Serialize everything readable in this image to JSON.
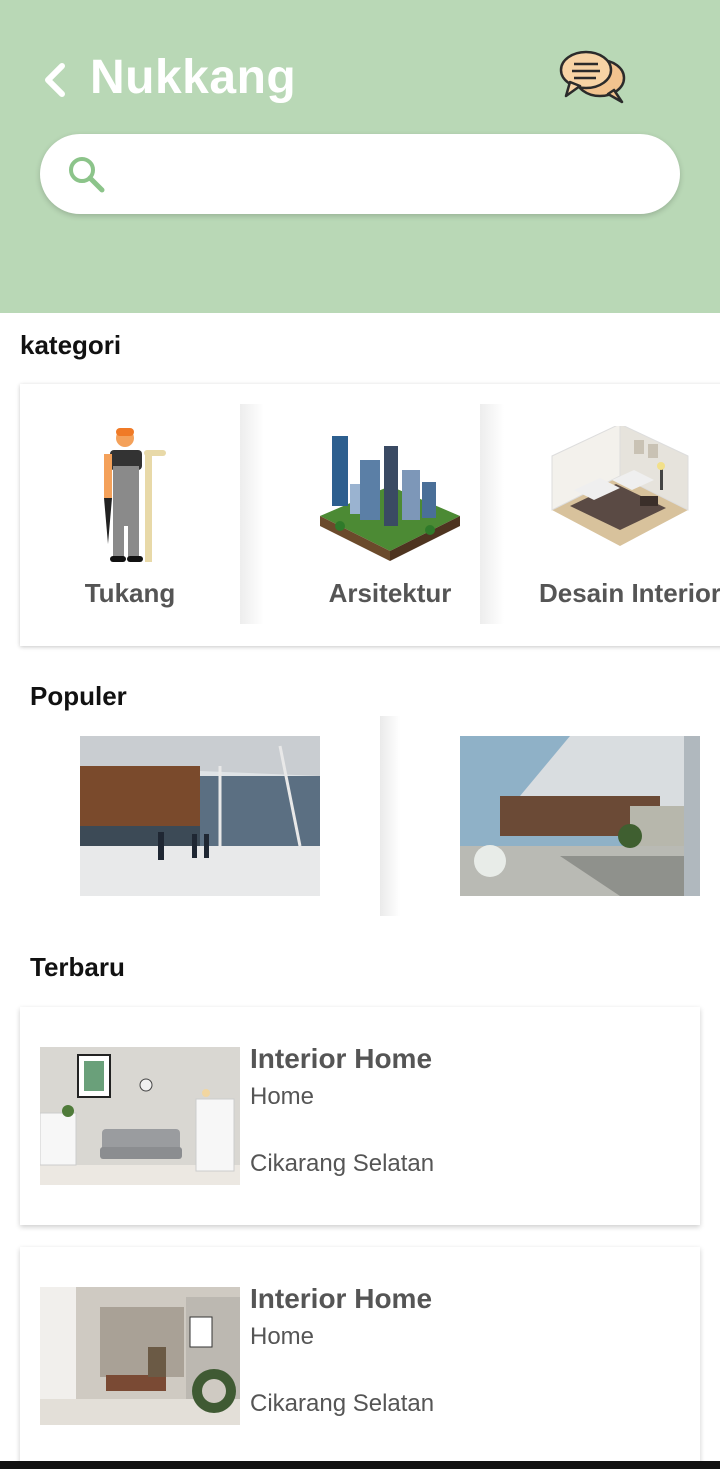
{
  "header": {
    "title": "Nukkang",
    "back_icon": "chevron-left-icon",
    "chat_icon": "chat-bubbles-icon"
  },
  "search": {
    "placeholder": "",
    "value": "",
    "icon": "search-icon"
  },
  "sections": {
    "categories": "kategori",
    "popular": "Populer",
    "latest": "Terbaru"
  },
  "categories": [
    {
      "label": "Tukang",
      "icon": "worker-icon"
    },
    {
      "label": "Arsitektur",
      "icon": "city-icon"
    },
    {
      "label": "Desain Interior",
      "icon": "room-interior-icon"
    }
  ],
  "latest": [
    {
      "title": "Interior Home",
      "subtitle": "Home",
      "location": "Cikarang Selatan"
    },
    {
      "title": "Interior Home",
      "subtitle": "Home",
      "location": "Cikarang Selatan"
    }
  ],
  "colors": {
    "header_bg": "#b9d8b6",
    "search_icon": "#8cc48a",
    "chat_icon": "#f2c38f"
  }
}
